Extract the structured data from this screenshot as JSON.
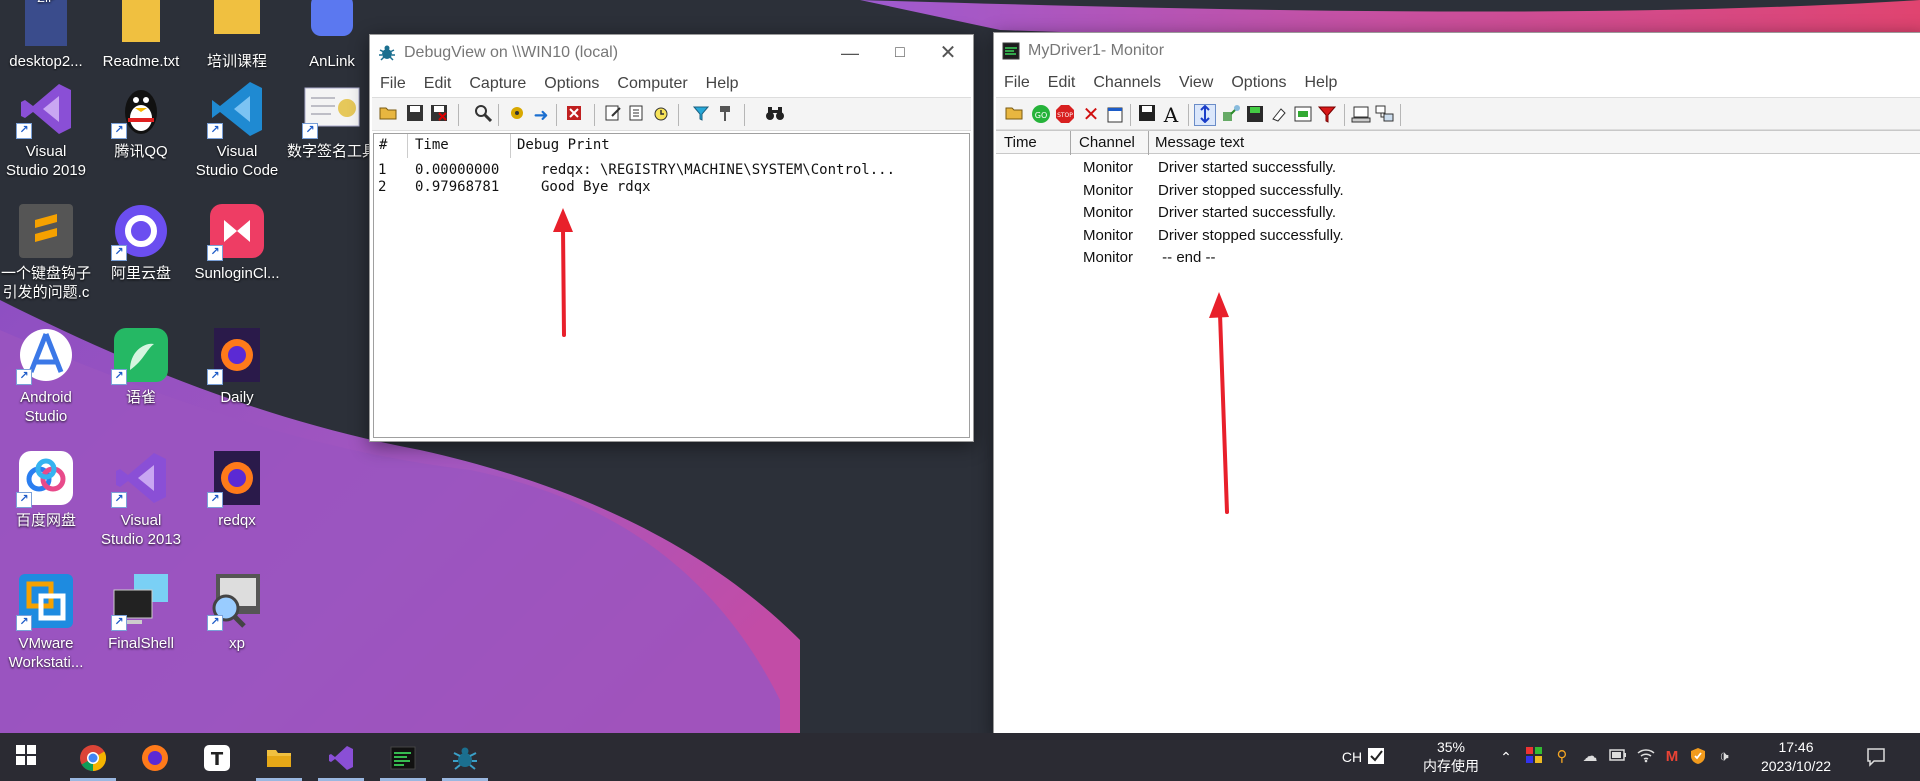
{
  "desktop": {
    "icons": [
      {
        "label": "desktop2...",
        "name": "zip-file",
        "icon": "zip-icon",
        "badge": "ZIP"
      },
      {
        "label": "Readme.txt",
        "name": "readme-txt",
        "icon": "text-file-icon"
      },
      {
        "label": "培训课程",
        "name": "training-course",
        "icon": "folder-icon"
      },
      {
        "label": "AnLink",
        "name": "anlink",
        "icon": "anlink-icon"
      },
      {
        "label": "Visual\nStudio 2019",
        "name": "visual-studio-2019",
        "icon": "visual-studio-icon"
      },
      {
        "label": "腾讯QQ",
        "name": "tencent-qq",
        "icon": "qq-penguin-icon"
      },
      {
        "label": "Visual\nStudio Code",
        "name": "vs-code",
        "icon": "vscode-icon"
      },
      {
        "label": "数字签名工具",
        "name": "digital-signature-tool",
        "icon": "certificate-icon"
      },
      {
        "label": "一个键盘钩子\n引发的问题.c",
        "name": "keyboard-hook-file",
        "icon": "sublime-file-icon"
      },
      {
        "label": "阿里云盘",
        "name": "aliyun-drive",
        "icon": "aliyun-drive-icon"
      },
      {
        "label": "SunloginCl...",
        "name": "sunlogin-client",
        "icon": "sunlogin-icon"
      },
      {
        "label": "Android\nStudio",
        "name": "android-studio",
        "icon": "android-studio-icon"
      },
      {
        "label": "语雀",
        "name": "yuque",
        "icon": "yuque-icon"
      },
      {
        "label": "Daily",
        "name": "firefox-daily",
        "icon": "firefox-icon"
      },
      {
        "label": "百度网盘",
        "name": "baidu-netdisk",
        "icon": "baidu-netdisk-icon"
      },
      {
        "label": "Visual\nStudio 2013",
        "name": "visual-studio-2013",
        "icon": "visual-studio-icon"
      },
      {
        "label": "redqx",
        "name": "redqx",
        "icon": "firefox-icon"
      },
      {
        "label": "VMware\nWorkstati...",
        "name": "vmware-workstation",
        "icon": "vmware-icon"
      },
      {
        "label": "FinalShell",
        "name": "finalshell",
        "icon": "monitor-icon"
      },
      {
        "label": "xp",
        "name": "xp",
        "icon": "magnifier-computer-icon"
      }
    ]
  },
  "debugview": {
    "title": "DebugView on \\\\WIN10 (local)",
    "menu": [
      "File",
      "Edit",
      "Capture",
      "Options",
      "Computer",
      "Help"
    ],
    "columns": [
      "#",
      "Time",
      "Debug Print"
    ],
    "rows": [
      {
        "num": "1",
        "time": "0.00000000",
        "text": "redqx: \\REGISTRY\\MACHINE\\SYSTEM\\Control..."
      },
      {
        "num": "2",
        "time": "0.97968781",
        "text": "Good Bye rdqx"
      }
    ]
  },
  "monitor": {
    "title": "MyDriver1- Monitor",
    "menu": [
      "File",
      "Edit",
      "Channels",
      "View",
      "Options",
      "Help"
    ],
    "columns": [
      "Time",
      "Channel",
      "Message text"
    ],
    "rows": [
      {
        "time": "",
        "channel": "Monitor",
        "message": "Driver started successfully."
      },
      {
        "time": "",
        "channel": "Monitor",
        "message": "Driver stopped successfully."
      },
      {
        "time": "",
        "channel": "Monitor",
        "message": "Driver started successfully."
      },
      {
        "time": "",
        "channel": "Monitor",
        "message": "Driver stopped successfully."
      },
      {
        "time": "",
        "channel": "Monitor",
        "message": " -- end --"
      }
    ]
  },
  "taskbar": {
    "apps": [
      {
        "name": "start",
        "icon": "windows-logo-icon"
      },
      {
        "name": "chrome",
        "icon": "chrome-icon"
      },
      {
        "name": "firefox",
        "icon": "firefox-icon"
      },
      {
        "name": "typora",
        "icon": "typora-icon",
        "glyph": "T"
      },
      {
        "name": "file-explorer",
        "icon": "folder-icon"
      },
      {
        "name": "visual-studio",
        "icon": "visual-studio-icon"
      },
      {
        "name": "monitor-app",
        "icon": "terminal-icon"
      },
      {
        "name": "debugview-app",
        "icon": "debugview-icon"
      }
    ],
    "input_method": "CH",
    "memory_percent": "35%",
    "memory_label": "内存使用",
    "time": "17:46",
    "date": "2023/10/22"
  },
  "colors": {
    "annotation_arrow": "#e8202b",
    "wallpaper_purple": "#9b55c4",
    "wallpaper_pink": "#d9468a",
    "taskbar": "#2b2b33"
  }
}
